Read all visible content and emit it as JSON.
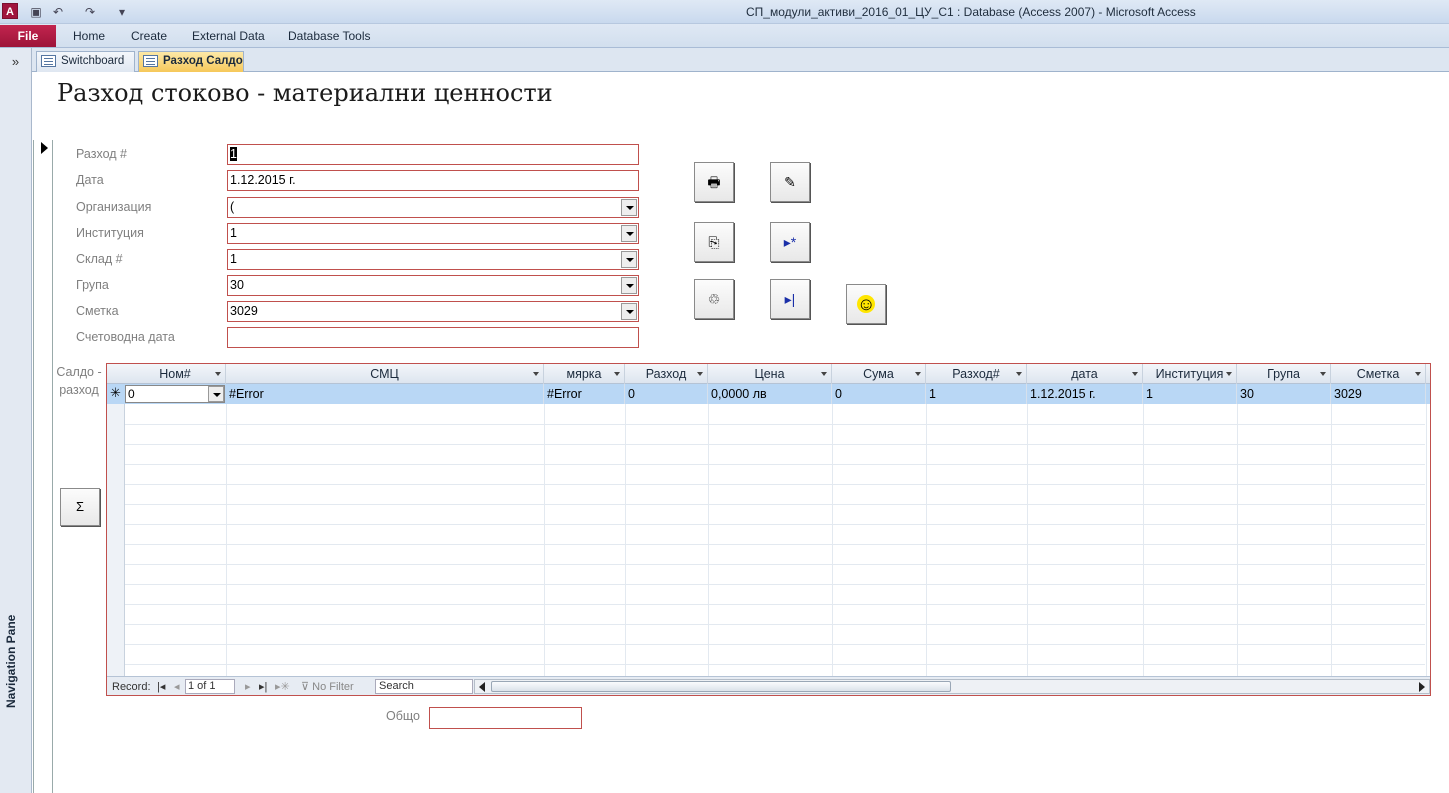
{
  "window": {
    "app_icon_letter": "A",
    "title": "СП_модули_активи_2016_01_ЦУ_С1 : Database (Access 2007)  -  Microsoft Access"
  },
  "ribbon": {
    "file": "File",
    "tabs": [
      "Home",
      "Create",
      "External Data",
      "Database Tools"
    ]
  },
  "nav_pane": {
    "toggle": "»",
    "label": "Navigation Pane"
  },
  "doc_tabs": [
    {
      "label": "Switchboard"
    },
    {
      "label": "Разход Салдо"
    }
  ],
  "form": {
    "title": "Разход  стоково - материални ценности",
    "fields": [
      {
        "label": "Разход #",
        "value": "1",
        "dropdown": false
      },
      {
        "label": "Дата",
        "value": "1.12.2015 г.",
        "dropdown": false
      },
      {
        "label": "Организация",
        "value": "(",
        "dropdown": true
      },
      {
        "label": "Институция",
        "value": "1",
        "dropdown": true
      },
      {
        "label": "Склад #",
        "value": "1",
        "dropdown": true
      },
      {
        "label": "Група",
        "value": "30",
        "dropdown": true
      },
      {
        "label": "Сметка",
        "value": "3029",
        "dropdown": true
      },
      {
        "label": "Счетоводна дата",
        "value": "",
        "dropdown": false
      }
    ],
    "buttons": {
      "print": "🖶",
      "edit": "✎",
      "copy": "⎘",
      "new_record": "▸*",
      "delete": "♲",
      "last_record": "▸|",
      "smiley": "☺",
      "sigma": "Σ"
    },
    "subform_label": "Салдо - разход",
    "total_label": "Общо",
    "total_value": ""
  },
  "subform": {
    "columns": [
      "Ном#",
      "СМЦ",
      "мярка",
      "Разход",
      "Цена",
      "Сума",
      "Разход#",
      "дата",
      "Институция",
      "Група",
      "Сметка"
    ],
    "new_row": [
      "0",
      "#Error",
      "#Error",
      "0",
      "0,0000 лв",
      "0",
      "1",
      "1.12.2015 г.",
      "1",
      "30",
      "3029"
    ],
    "new_row_marker": "✳",
    "navbar": {
      "record_label": "Record:",
      "record_pos": "1 of 1",
      "filter": "No Filter",
      "search": "Search"
    }
  }
}
